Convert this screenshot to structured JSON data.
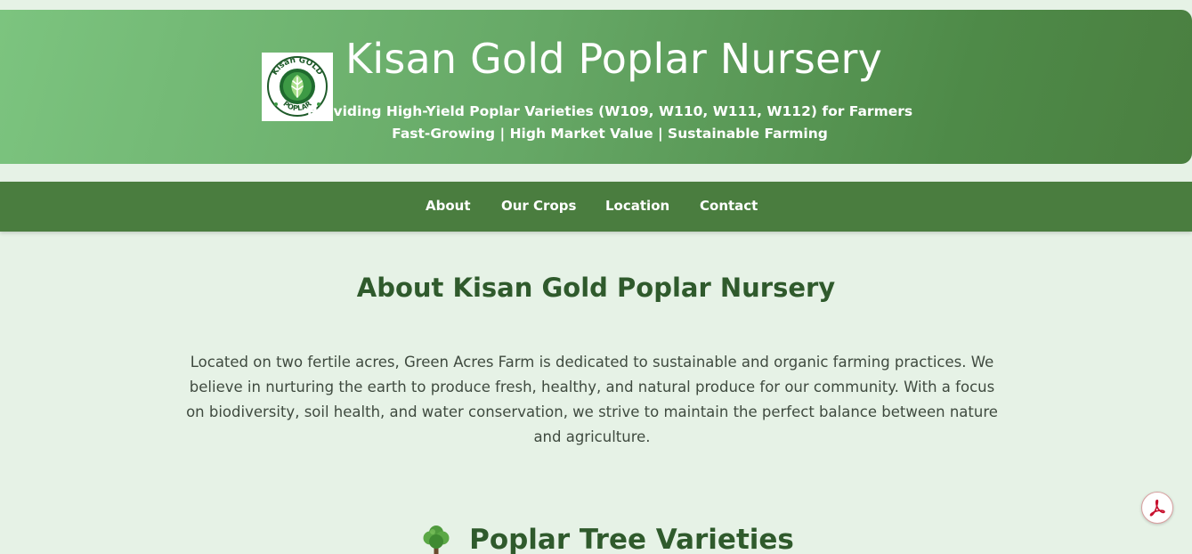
{
  "header": {
    "logo": {
      "ring_text_top": "Kisan GOLD",
      "ring_text_bottom": "POPLAR"
    },
    "title": "Kisan Gold Poplar Nursery",
    "tagline_line1": "Providing High-Yield Poplar Varieties (W109, W110, W111, W112) for Farmers",
    "tagline_line2": "Fast-Growing | High Market Value | Sustainable Farming"
  },
  "nav": {
    "items": [
      {
        "label": "About"
      },
      {
        "label": "Our Crops"
      },
      {
        "label": "Location"
      },
      {
        "label": "Contact"
      }
    ]
  },
  "about": {
    "title": "About Kisan Gold Poplar Nursery",
    "text": "Located on two fertile acres, Green Acres Farm is dedicated to sustainable and organic farming practices. We believe in nurturing the earth to produce fresh, healthy, and natural produce for our community. With a focus on biodiversity, soil health, and water conservation, we strive to maintain the perfect balance between nature and agriculture."
  },
  "varieties": {
    "icon": "tree-icon",
    "title": "Poplar Tree Varieties"
  },
  "floating": {
    "icon": "pdf-icon"
  },
  "colors": {
    "page_bg": "#e6f2e6",
    "header_gradient_start": "#7cc47f",
    "header_gradient_end": "#4a7f40",
    "navbar_bg": "#4a7d3f",
    "heading_green": "#2f5a2c",
    "body_text": "#3f4a3f"
  }
}
